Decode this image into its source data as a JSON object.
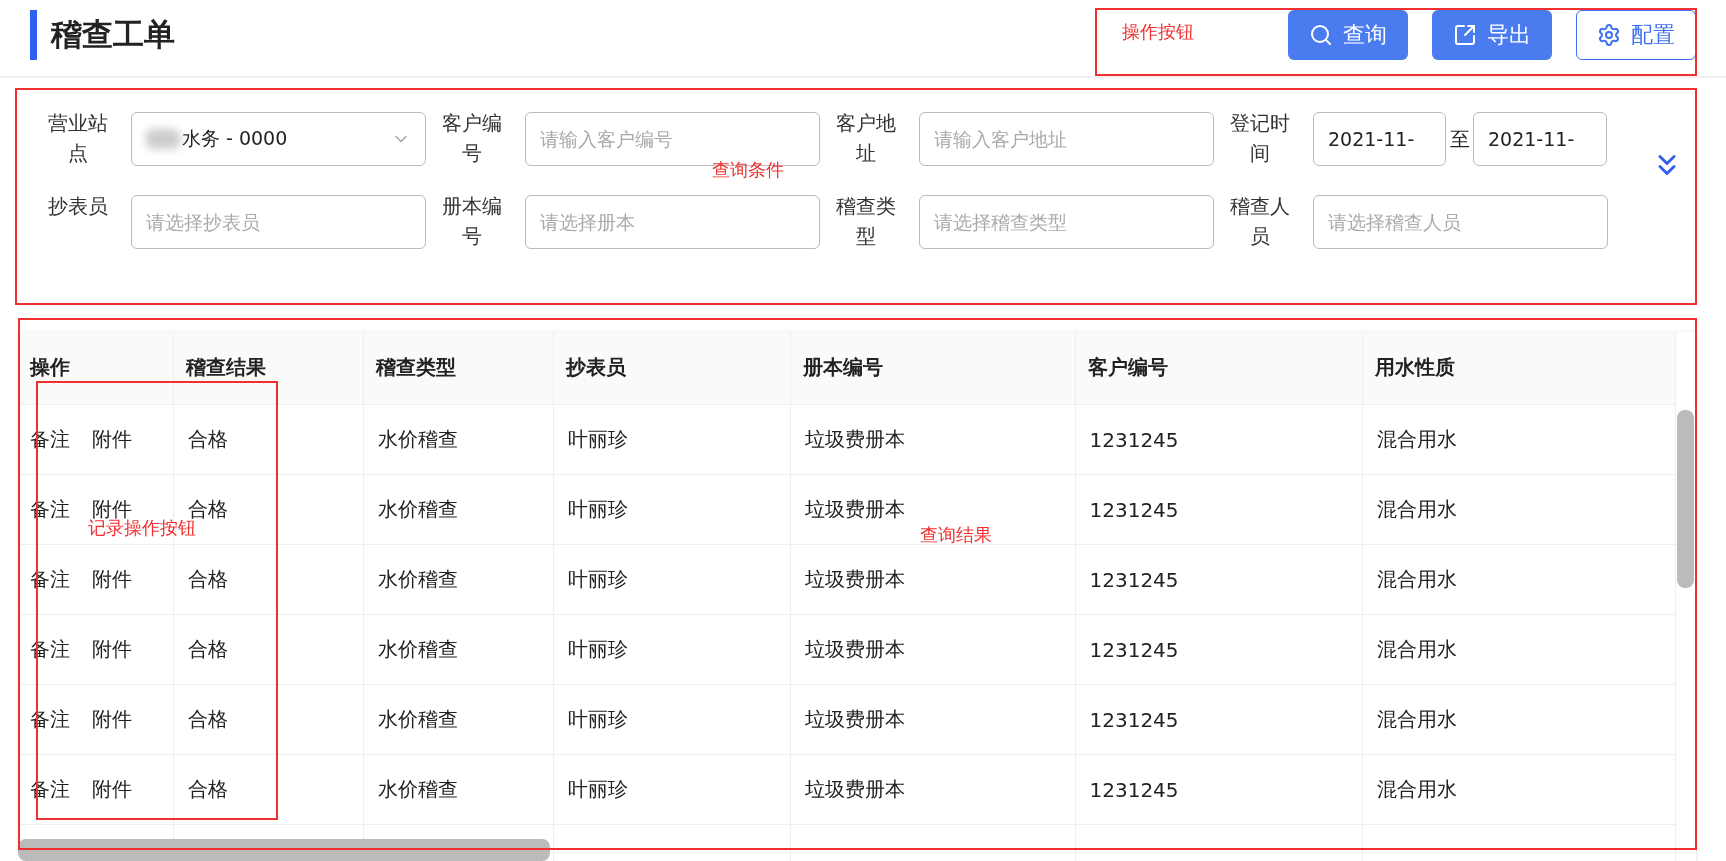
{
  "page": {
    "title": "稽查工单"
  },
  "toolbar": {
    "buttons": [
      {
        "label": "查询",
        "kind": "search"
      },
      {
        "label": "导出",
        "kind": "export"
      },
      {
        "label": "配置",
        "kind": "config"
      }
    ]
  },
  "filters": [
    [
      {
        "label": "营业站点",
        "kind": "select",
        "value": "水务 - 0000"
      },
      {
        "label": "客户编号",
        "kind": "text",
        "placeholder": "请输入客户编号"
      },
      {
        "label": "客户地址",
        "kind": "text",
        "placeholder": "请输入客户地址"
      },
      {
        "label": "登记时间",
        "kind": "date_range",
        "values": [
          "2021-11-",
          "2021-11-"
        ],
        "separator": "至"
      }
    ],
    [
      {
        "label": "抄表员",
        "kind": "text",
        "placeholder": "请选择抄表员"
      },
      {
        "label": "册本编号",
        "kind": "text",
        "placeholder": "请选择册本"
      },
      {
        "label": "稽查类型",
        "kind": "text",
        "placeholder": "请选择稽查类型"
      },
      {
        "label": "稽查人员",
        "kind": "text",
        "placeholder": "请选择稽查人员"
      }
    ]
  ],
  "table": {
    "columns": [
      "操作",
      "稽查结果",
      "稽查类型",
      "抄表员",
      "册本编号",
      "客户编号",
      "用水性质"
    ],
    "rows": [
      {
        "cells": [
          {
            "links": [
              "备注",
              "附件"
            ]
          },
          "合格",
          "水价稽查",
          "叶丽珍",
          "垃圾费册本",
          "1231245",
          "混合用水"
        ]
      },
      {
        "cells": [
          {
            "links": [
              "备注",
              "附件"
            ]
          },
          "合格",
          "水价稽查",
          "叶丽珍",
          "垃圾费册本",
          "1231245",
          "混合用水"
        ]
      },
      {
        "cells": [
          {
            "links": [
              "备注",
              "附件"
            ]
          },
          "合格",
          "水价稽查",
          "叶丽珍",
          "垃圾费册本",
          "1231245",
          "混合用水"
        ]
      },
      {
        "cells": [
          {
            "links": [
              "备注",
              "附件"
            ]
          },
          "合格",
          "水价稽查",
          "叶丽珍",
          "垃圾费册本",
          "1231245",
          "混合用水"
        ]
      },
      {
        "cells": [
          {
            "links": [
              "备注",
              "附件"
            ]
          },
          "合格",
          "水价稽查",
          "叶丽珍",
          "垃圾费册本",
          "1231245",
          "混合用水"
        ]
      },
      {
        "cells": [
          {
            "links": [
              "备注",
              "附件"
            ]
          },
          "合格",
          "水价稽查",
          "叶丽珍",
          "垃圾费册本",
          "1231245",
          "混合用水"
        ]
      }
    ]
  },
  "annotations": [
    {
      "label": "操作按钮"
    },
    {
      "label": "查询条件"
    },
    {
      "label": "查询结果"
    },
    {
      "label": "记录操作按钮"
    }
  ]
}
